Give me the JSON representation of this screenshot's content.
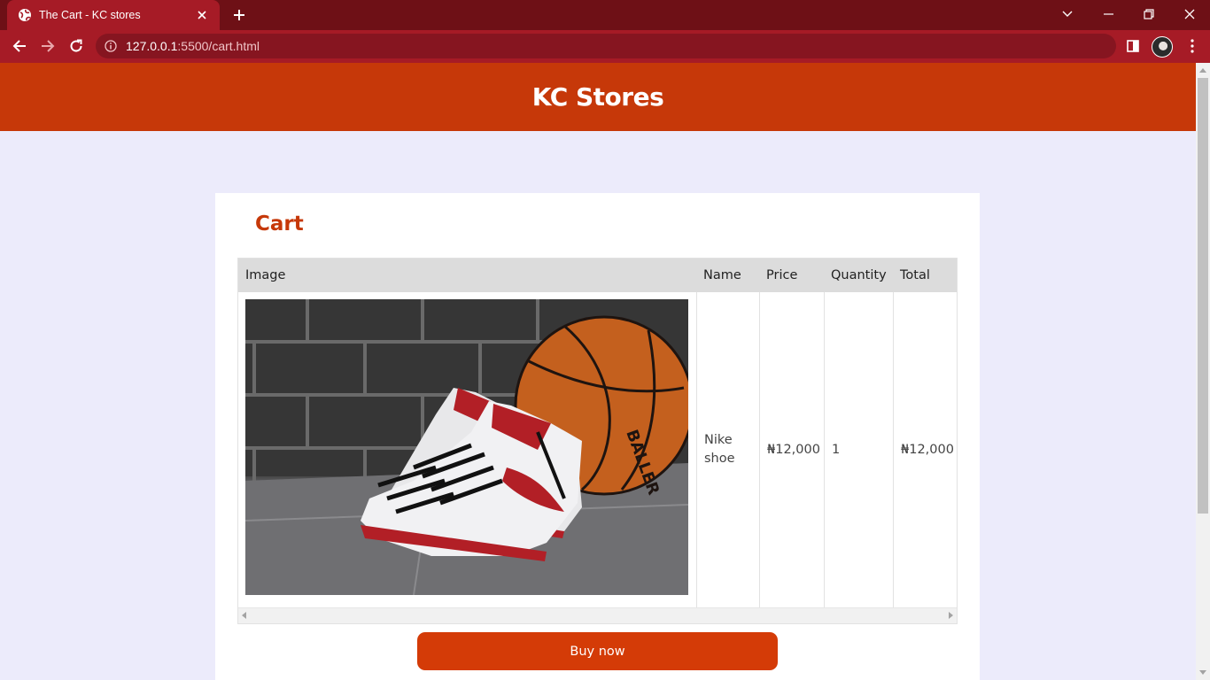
{
  "browser": {
    "tab_title": "The Cart - KC stores",
    "url_host": "127.0.0.1",
    "url_rest": ":5500/cart.html"
  },
  "site": {
    "title": "KC Stores"
  },
  "cart": {
    "heading": "Cart",
    "columns": [
      "Image",
      "Name",
      "Price",
      "Quantity",
      "Total"
    ],
    "rows": [
      {
        "image_alt": "Nike shoe",
        "name": "Nike shoe",
        "price": "₦12,000",
        "quantity": "1",
        "total": "₦12,000"
      }
    ],
    "buy_label": "Buy now"
  },
  "colors": {
    "brand": "#c63809",
    "button": "#d43b07",
    "tab_strip": "#6e1016",
    "toolbar": "#a61b26",
    "page_bg": "#ecebfb"
  }
}
